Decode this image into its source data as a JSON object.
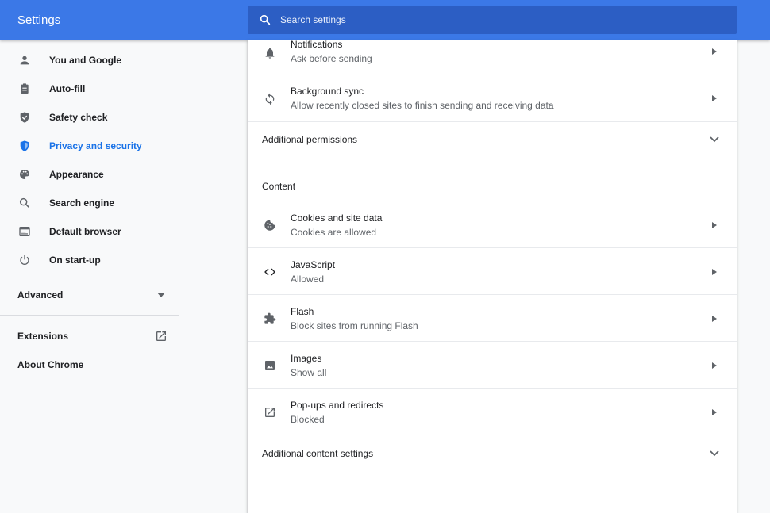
{
  "header": {
    "title": "Settings",
    "search_placeholder": "Search settings",
    "accent_color": "#3b78e7"
  },
  "sidebar": {
    "items": [
      {
        "label": "You and Google",
        "icon": "person-icon"
      },
      {
        "label": "Auto-fill",
        "icon": "clipboard-icon"
      },
      {
        "label": "Safety check",
        "icon": "shield-check-icon"
      },
      {
        "label": "Privacy and security",
        "icon": "shield-icon",
        "active": true
      },
      {
        "label": "Appearance",
        "icon": "palette-icon"
      },
      {
        "label": "Search engine",
        "icon": "search-icon"
      },
      {
        "label": "Default browser",
        "icon": "browser-icon"
      },
      {
        "label": "On start-up",
        "icon": "power-icon"
      }
    ],
    "advanced_label": "Advanced",
    "extensions_label": "Extensions",
    "about_label": "About Chrome"
  },
  "content": {
    "notifications": {
      "title": "Notifications",
      "subtitle": "Ask before sending",
      "icon": "bell-icon"
    },
    "background_sync": {
      "title": "Background sync",
      "subtitle": "Allow recently closed sites to finish sending and receiving data",
      "icon": "sync-icon"
    },
    "additional_permissions_label": "Additional permissions",
    "content_heading": "Content",
    "cookies": {
      "title": "Cookies and site data",
      "subtitle": "Cookies are allowed",
      "icon": "cookie-icon"
    },
    "javascript": {
      "title": "JavaScript",
      "subtitle": "Allowed",
      "icon": "code-icon"
    },
    "flash": {
      "title": "Flash",
      "subtitle": "Block sites from running Flash",
      "icon": "puzzle-icon"
    },
    "images": {
      "title": "Images",
      "subtitle": "Show all",
      "icon": "image-icon"
    },
    "popups": {
      "title": "Pop-ups and redirects",
      "subtitle": "Blocked",
      "icon": "open-in-new-icon"
    },
    "additional_content_label": "Additional content settings"
  }
}
